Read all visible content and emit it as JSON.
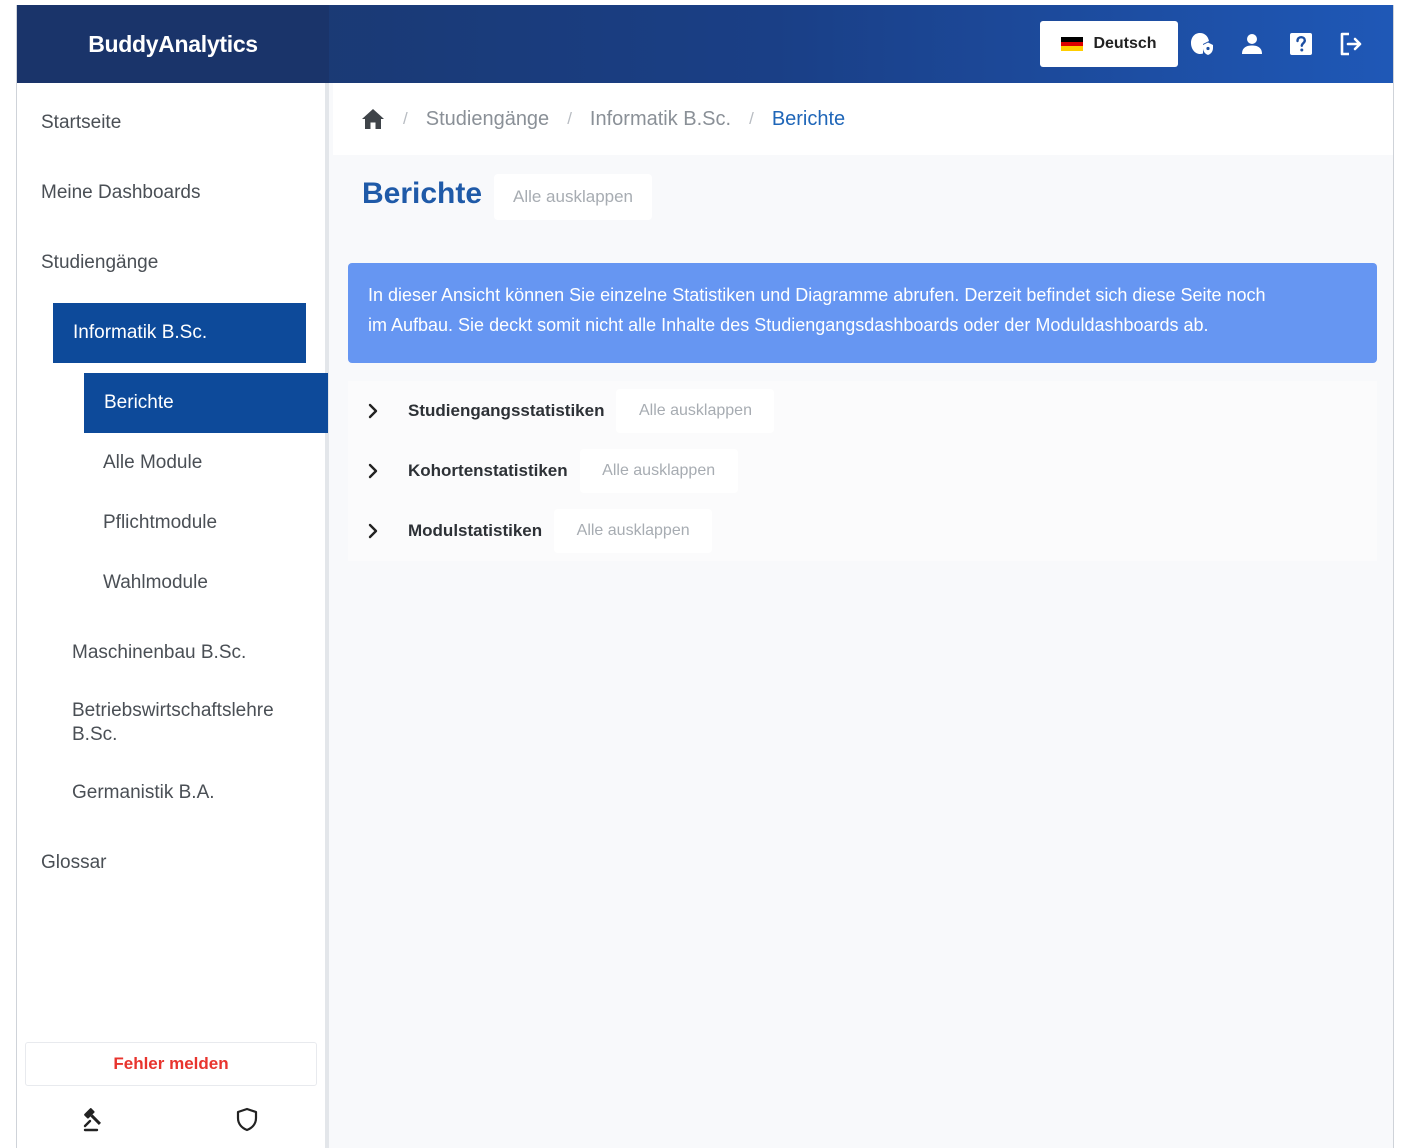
{
  "app": {
    "brand": "BuddyAnalytics"
  },
  "header": {
    "language": {
      "label": "Deutsch",
      "flag_colors": [
        "#000000",
        "#dd0000",
        "#ffce00"
      ]
    },
    "icons": [
      "user-shield-icon",
      "user-icon",
      "help-icon",
      "logout-icon"
    ]
  },
  "sidebar": {
    "items": [
      {
        "label": "Startseite",
        "level": 0,
        "active": false
      },
      {
        "label": "Meine Dashboards",
        "level": 0,
        "active": false
      },
      {
        "label": "Studiengänge",
        "level": 0,
        "active": false
      },
      {
        "label": "Informatik B.Sc.",
        "level": 1,
        "active": true
      },
      {
        "label": "Berichte",
        "level": 2,
        "active": true
      },
      {
        "label": "Alle Module",
        "level": 2,
        "active": false
      },
      {
        "label": "Pflichtmodule",
        "level": 2,
        "active": false
      },
      {
        "label": "Wahlmodule",
        "level": 2,
        "active": false
      },
      {
        "label": "Maschinenbau B.Sc.",
        "level": 1,
        "active": false
      },
      {
        "label": "Betriebswirtschaftslehre",
        "label_line2": "B.Sc.",
        "level": 1,
        "active": false
      },
      {
        "label": "Germanistik B.A.",
        "level": 1,
        "active": false
      },
      {
        "label": "Glossar",
        "level": 0,
        "active": false
      }
    ],
    "report_button": "Fehler melden",
    "footer_icons": [
      "gavel-icon",
      "shield-icon"
    ]
  },
  "breadcrumb": {
    "home_icon": "home-icon",
    "items": [
      "Studiengänge",
      "Informatik B.Sc.",
      "Berichte"
    ],
    "separator": "/"
  },
  "main": {
    "title": "Berichte",
    "expand_all": "Alle ausklappen",
    "info_line1": "In dieser Ansicht können Sie einzelne Statistiken und Diagramme abrufen. Derzeit befindet sich diese Seite noch",
    "info_line2": "im Aufbau. Sie deckt somit nicht alle Inhalte des Studiengangsdashboards oder der Moduldashboards ab.",
    "sections": [
      {
        "title": "Studiengangsstatistiken",
        "expand": "Alle ausklappen"
      },
      {
        "title": "Kohortenstatistiken",
        "expand": "Alle ausklappen"
      },
      {
        "title": "Modulstatistiken",
        "expand": "Alle ausklappen"
      }
    ]
  },
  "colors": {
    "header_dark": "#1a346a",
    "active_nav": "#0d4a9a",
    "title_blue": "#1f5aa8",
    "info_box": "#6696f2",
    "report_red": "#e8342e"
  }
}
